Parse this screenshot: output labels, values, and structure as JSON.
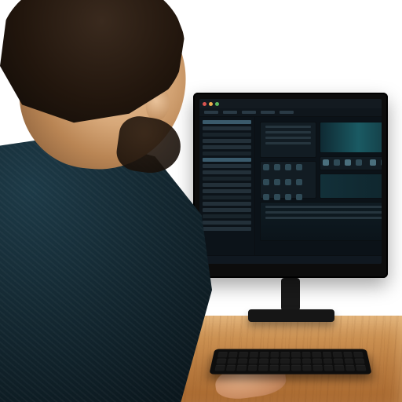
{
  "description": "Photorealistic/rendered image of a young man with short dark hair and a beard, seen from behind-left, wearing a dark teal knit top, sitting at a light wooden desk with a black keyboard and a black desktop monitor showing a dark, multi-panel software interface (resembling an IDE or audio/video editor). No legible on-screen text.",
  "monitor": {
    "brand_label": "",
    "titlebar_dots": [
      "#d9534f",
      "#f0ad4e",
      "#5cb85c"
    ],
    "statusbar_text": ""
  }
}
